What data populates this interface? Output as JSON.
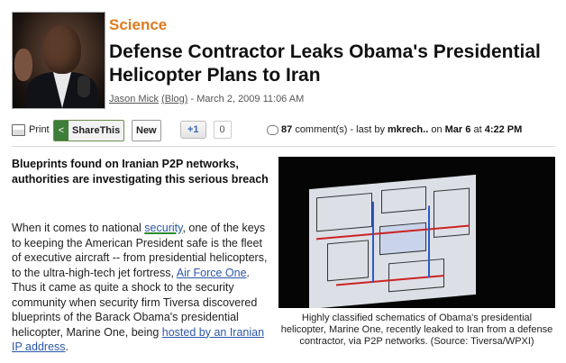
{
  "article": {
    "category": "Science",
    "title": "Defense Contractor Leaks Obama's Presidential Helicopter Plans to Iran",
    "author": "Jason Mick",
    "blog_link": "(Blog)",
    "date": "- March 2, 2009 11:06 AM"
  },
  "toolbar": {
    "print_label": "Print",
    "sharethis_label": "ShareThis",
    "new_label": "New",
    "plusone_label": "+1",
    "plusone_count": "0",
    "comment_count": "87",
    "comments_text": "comment(s) - last by",
    "last_commenter": "mkrech..",
    "on_text": "on",
    "last_date": "Mar 6",
    "at_text": "at",
    "last_time": "4:22 PM"
  },
  "subhead": "Blueprints found on Iranian P2P networks, authorities are investigating this serious breach",
  "body": {
    "t1": "When it comes to national ",
    "link_security": "security",
    "t2": ", one of the keys to keeping the American President safe is the fleet of executive aircraft -- from presidential helicopters, to the ultra-high-tech jet fortress, ",
    "link_af1": "Air Force One",
    "t3": ".  Thus it came as quite a shock to the security community when security firm Tiversa discovered blueprints of the Barack Obama's presidential helicopter, Marine One, being ",
    "link_hosted": "hosted by an Iranian IP address",
    "t4": "."
  },
  "figure": {
    "caption": "Highly classified schematics of Obama's presidential helicopter, Marine One, recently leaked to Iran from a defense contractor, via P2P networks.  (Source: Tiversa/WPXI)"
  },
  "icons": [
    "author-photo",
    "print-icon",
    "sharethis-icon",
    "comment-bubble-icon"
  ]
}
